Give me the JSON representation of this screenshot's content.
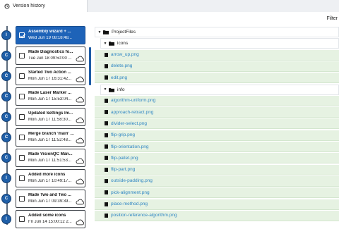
{
  "tab": {
    "title": "Version history",
    "icon": "history-icon"
  },
  "toolbar": {
    "filter_label": "Filter"
  },
  "history": [
    {
      "node": "I",
      "title": "Assembly wizard + ...",
      "date": "Wed Jun 19 08:18:48...",
      "selected": true,
      "checked": true,
      "cloud": false
    },
    {
      "node": "C",
      "title": "Made Diagnostics fo...",
      "date": "Tue Jun 18 09:50:00 ...",
      "selected": false,
      "checked": false,
      "cloud": true
    },
    {
      "node": "C",
      "title": "Started Two Action ...",
      "date": "Mon Jun 17 16:31:42...",
      "selected": false,
      "checked": false,
      "cloud": true
    },
    {
      "node": "C",
      "title": "Made Laser Marker ...",
      "date": "Mon Jun 17 15:53:04...",
      "selected": false,
      "checked": false,
      "cloud": true
    },
    {
      "node": "C",
      "title": "Updated Settings Im...",
      "date": "Mon Jun 17 11:58:30...",
      "selected": false,
      "checked": false,
      "cloud": true
    },
    {
      "node": "C",
      "title": "Merge branch 'main' ...",
      "date": "Mon Jun 17 11:52:48...",
      "selected": false,
      "checked": false,
      "cloud": true
    },
    {
      "node": "C",
      "title": "Made VisionQC Man...",
      "date": "Mon Jun 17 11:51:53...",
      "selected": false,
      "checked": false,
      "cloud": true
    },
    {
      "node": "I",
      "title": "Added more icons",
      "date": "Mon Jun 17 10:49:17...",
      "selected": false,
      "checked": false,
      "cloud": true
    },
    {
      "node": "C",
      "title": "Made Two and Two ...",
      "date": "Mon Jun 17 09:39:39...",
      "selected": false,
      "checked": false,
      "cloud": true
    },
    {
      "node": "I",
      "title": "Added some icons",
      "date": "Fri Jun 14 15:00:12 2...",
      "selected": false,
      "checked": false,
      "cloud": true
    }
  ],
  "tree": {
    "root": "ProjectFiles",
    "folders": [
      {
        "name": "icons",
        "files": [
          "arrow_up.png",
          "delete.png",
          "edit.png"
        ]
      },
      {
        "name": "info",
        "files": [
          "algorithm-uniform.png",
          "approach-retract.png",
          "divider-select.png",
          "flip-grip.png",
          "flip-orientation.png",
          "flip-pallet.png",
          "flip-part.png",
          "outside-padding.png",
          "pick-alignment.png",
          "place-method.png",
          "position-reference-algorithm.png"
        ]
      }
    ]
  },
  "colors": {
    "selected": "#1e63b8",
    "node": "#1f5fa8",
    "file_bg": "#e6f2e2",
    "file_text": "#2f86c3"
  }
}
